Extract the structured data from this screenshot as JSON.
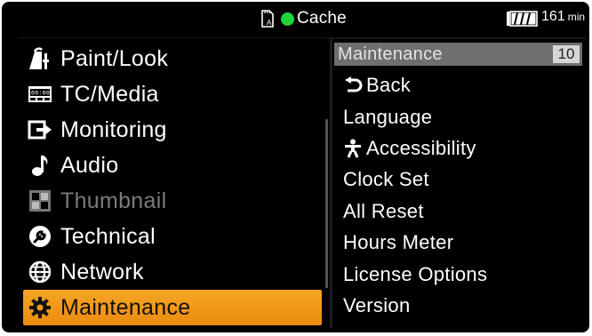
{
  "status": {
    "icon_media": "media-slot-icon",
    "indicator_color": "#1fd43a",
    "label": "Cache",
    "battery_icon": "battery-icon",
    "battery_value": "161",
    "battery_unit": "min"
  },
  "left_menu": {
    "items": [
      {
        "label": "Paint/Look",
        "icon": "paint-look-icon",
        "state": "normal"
      },
      {
        "label": "TC/Media",
        "icon": "tc-media-icon",
        "state": "normal"
      },
      {
        "label": "Monitoring",
        "icon": "monitoring-icon",
        "state": "normal"
      },
      {
        "label": "Audio",
        "icon": "audio-note-icon",
        "state": "normal"
      },
      {
        "label": "Thumbnail",
        "icon": "thumbnail-icon",
        "state": "disabled"
      },
      {
        "label": "Technical",
        "icon": "wrench-icon",
        "state": "normal"
      },
      {
        "label": "Network",
        "icon": "globe-icon",
        "state": "normal"
      },
      {
        "label": "Maintenance",
        "icon": "gear-icon",
        "state": "selected"
      }
    ],
    "selected_color": "#f29b1c"
  },
  "right_menu": {
    "header": "Maintenance",
    "page": "10",
    "items": [
      {
        "label": "Back",
        "icon": "back-arrow-icon"
      },
      {
        "label": "Language"
      },
      {
        "label": "Accessibility",
        "icon": "accessibility-icon"
      },
      {
        "label": "Clock Set"
      },
      {
        "label": "All Reset"
      },
      {
        "label": "Hours Meter"
      },
      {
        "label": "License Options"
      },
      {
        "label": "Version"
      }
    ]
  }
}
